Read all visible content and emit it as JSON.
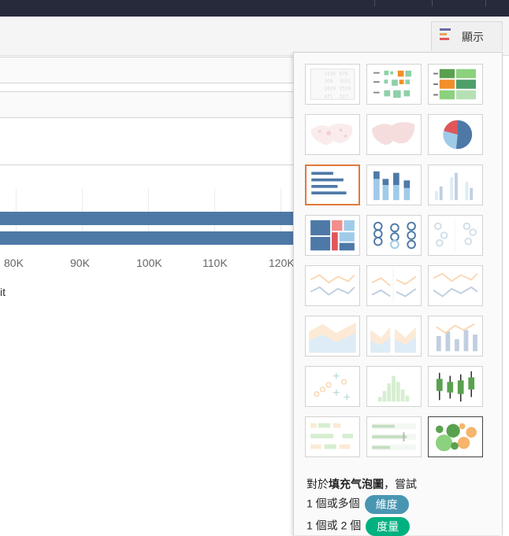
{
  "show_me": {
    "label": "顯示"
  },
  "axis": {
    "ticks": [
      "80K",
      "90K",
      "100K",
      "110K",
      "120K"
    ],
    "title": "it"
  },
  "chart_data": {
    "type": "bar",
    "series": [
      {
        "values": [
          125000,
          125000
        ]
      }
    ],
    "xlabel": "…it",
    "ylabel": "",
    "xlim": [
      75000,
      125000
    ],
    "x_tick_labels": [
      "80K",
      "90K",
      "100K",
      "110K",
      "120K"
    ],
    "grid": true
  },
  "chart_types": [
    {
      "name": "text-table",
      "state": "disabled-off"
    },
    {
      "name": "heat-map",
      "state": "off"
    },
    {
      "name": "highlight-table",
      "state": "off"
    },
    {
      "name": "symbol-map",
      "state": "disabled"
    },
    {
      "name": "filled-map",
      "state": "disabled"
    },
    {
      "name": "pie-chart",
      "state": "off"
    },
    {
      "name": "horizontal-bars",
      "state": "selected"
    },
    {
      "name": "stacked-bars",
      "state": "off"
    },
    {
      "name": "side-by-side-bars",
      "state": "disabled"
    },
    {
      "name": "treemap",
      "state": "off"
    },
    {
      "name": "circle-views",
      "state": "off"
    },
    {
      "name": "side-by-side-circles",
      "state": "disabled"
    },
    {
      "name": "lines-continuous",
      "state": "disabled"
    },
    {
      "name": "lines-discrete",
      "state": "disabled"
    },
    {
      "name": "dual-lines",
      "state": "disabled"
    },
    {
      "name": "area-continuous",
      "state": "disabled"
    },
    {
      "name": "area-discrete",
      "state": "disabled"
    },
    {
      "name": "dual-combination",
      "state": "disabled"
    },
    {
      "name": "scatter-plot",
      "state": "disabled"
    },
    {
      "name": "histogram",
      "state": "disabled"
    },
    {
      "name": "box-and-whisker",
      "state": "off"
    },
    {
      "name": "gantt-chart",
      "state": "disabled"
    },
    {
      "name": "bullet-graph",
      "state": "disabled"
    },
    {
      "name": "packed-bubbles",
      "state": "active"
    }
  ],
  "hint": {
    "prefix": "對於",
    "chart_name": "填充气泡圖",
    "suffix": "，嘗試",
    "line1_text": "1 個或多個",
    "line1_pill": "維度",
    "line2_text": "1 個或 2 個",
    "line2_pill": "度量"
  },
  "colors": {
    "dimension_pill": "#4996b2",
    "measure_pill": "#00b180",
    "bar": "#4e79a7",
    "selected_border": "#e07b39"
  }
}
